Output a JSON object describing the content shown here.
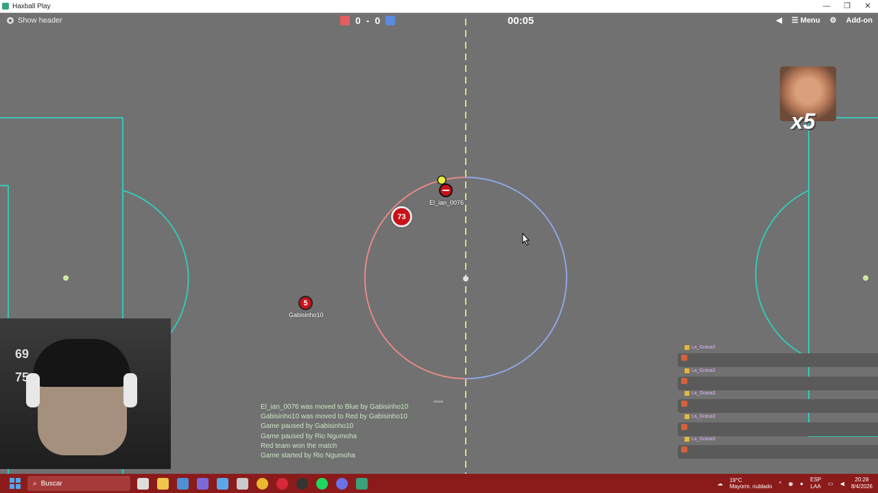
{
  "window": {
    "title": "Haxball Play",
    "controls": [
      "—",
      "❐",
      "✕"
    ]
  },
  "hud": {
    "show_header": "Show header",
    "score_red": "0",
    "score_sep": "-",
    "score_blue": "0",
    "timer": "00:05",
    "menu": "Menu",
    "addon": "Add-on",
    "colors": {
      "red": "#e35f5f",
      "blue": "#5b8be0"
    }
  },
  "players": [
    {
      "name": "",
      "number": "73",
      "team": "red"
    },
    {
      "name": "Gabisinho10",
      "number": "5",
      "team": "red"
    },
    {
      "name": "El_ian_0076",
      "number": "",
      "team": "blue"
    }
  ],
  "meme": {
    "caption": "x5"
  },
  "log": [
    "El_ian_0076 was moved to Blue by Gabisinho10",
    "Gabisinho10 was moved to Red by Gabisinho10",
    "Game paused by Gabisinho10",
    "Game paused by Rio Ngumoha",
    "Red team won the match",
    "Game started by Rio Ngumoha"
  ],
  "chat": [
    {
      "user": "La_Grasa3"
    },
    {
      "user": "La_Grasa3"
    },
    {
      "user": "La_Grasa3"
    },
    {
      "user": "La_Grasa3"
    },
    {
      "user": "La_Grasa3"
    }
  ],
  "webcam": {
    "numbers": [
      "69",
      "75"
    ]
  },
  "taskbar": {
    "search": "Buscar",
    "weather_temp": "19°C",
    "weather_desc": "Mayorm. nublado",
    "lang": "ESP",
    "lang2": "LAA",
    "time": "20:28",
    "date": "8/4/2026"
  }
}
